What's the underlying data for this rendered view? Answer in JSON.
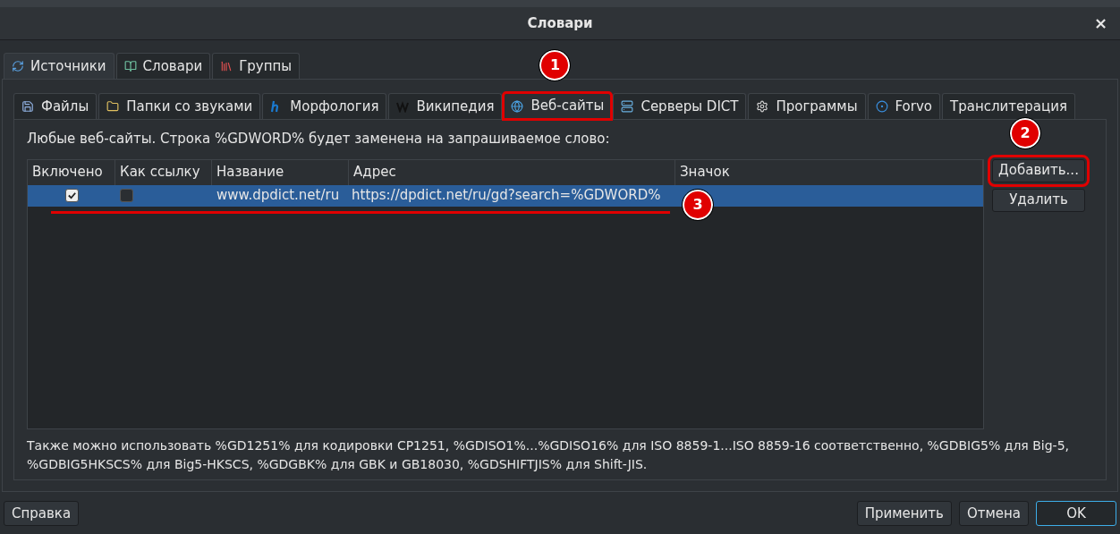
{
  "window": {
    "title": "Словари",
    "close": "×"
  },
  "tabs": [
    {
      "label": "Источники",
      "selected": true
    },
    {
      "label": "Словари",
      "selected": false
    },
    {
      "label": "Группы",
      "selected": false
    }
  ],
  "subtabs": [
    {
      "label": "Файлы",
      "selected": false
    },
    {
      "label": "Папки со звуками",
      "selected": false
    },
    {
      "label": "Морфология",
      "selected": false
    },
    {
      "label": "Википедия",
      "selected": false
    },
    {
      "label": "Веб-сайты",
      "selected": true,
      "annotation": "1"
    },
    {
      "label": "Серверы DICT",
      "selected": false
    },
    {
      "label": "Программы",
      "selected": false
    },
    {
      "label": "Forvo",
      "selected": false
    },
    {
      "label": "Транслитерация",
      "selected": false
    }
  ],
  "description": "Любые веб-сайты. Строка %GDWORD% будет заменена на запрашиваемое слово:",
  "table": {
    "columns": [
      "Включено",
      "Как ссылку",
      "Название",
      "Адрес",
      "Значок"
    ],
    "rows": [
      {
        "enabled": true,
        "as_link": false,
        "name": "www.dpdict.net/ru",
        "address": "https://dpdict.net/ru/gd?search=%GDWORD%",
        "selected": true,
        "annotation": "3"
      }
    ]
  },
  "side_buttons": [
    {
      "label": "Добавить...",
      "annotation": "2"
    },
    {
      "label": "Удалить"
    }
  ],
  "note": "Также можно использовать %GD1251% для кодировки CP1251, %GDISO1%...%GDISO16% для ISO 8859-1...ISO 8859-16 соответственно, %GDBIG5% для Big-5, %GDBIG5HKSCS% для Big5-HKSCS, %GDGBK% для GBK и GB18030, %GDSHIFTJIS% для Shift-JIS.",
  "footer_left": "Справка",
  "footer_buttons": [
    {
      "label": "Применить",
      "default": false
    },
    {
      "label": "Отмена",
      "default": false
    },
    {
      "label": "OK",
      "default": true
    }
  ]
}
